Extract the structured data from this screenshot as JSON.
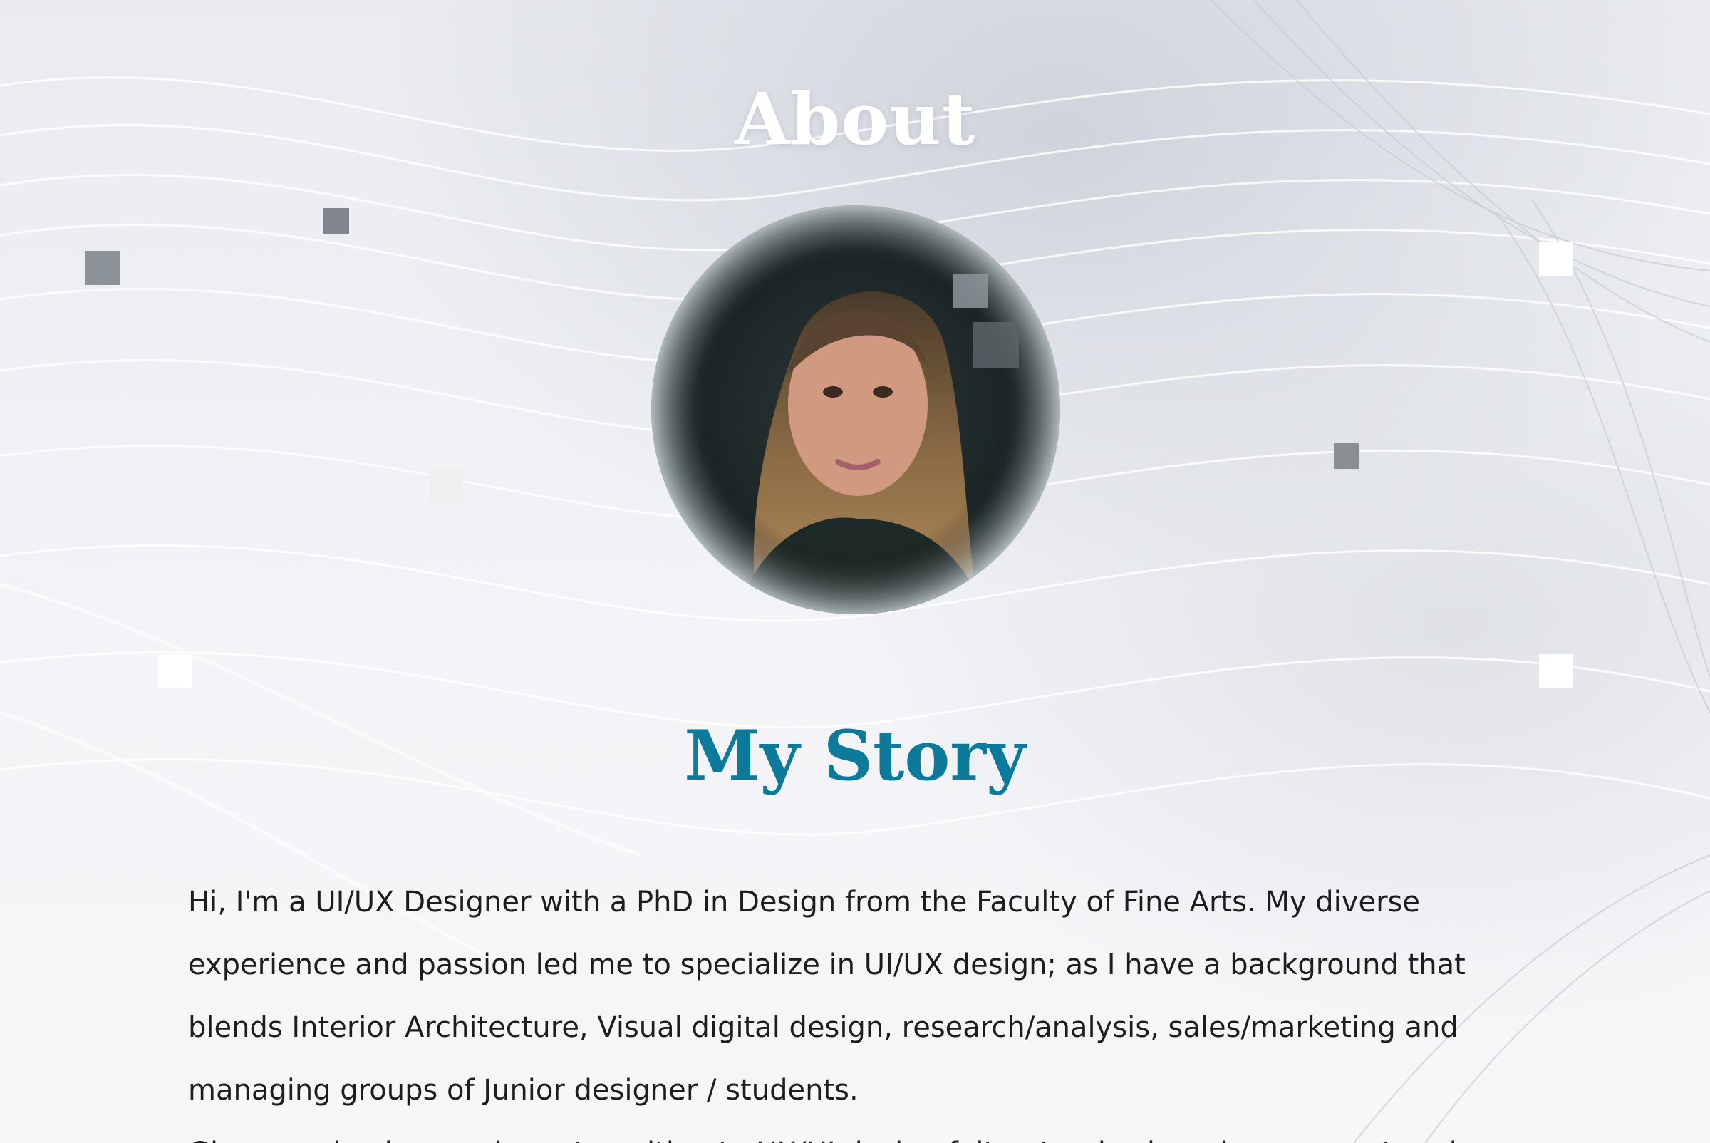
{
  "page": {
    "header_title": "About",
    "section_title": "My Story",
    "story_paragraphs": [
      "Hi, I'm a UI/UX Designer with a PhD in Design from the Faculty of Fine Arts. My diverse experience and passion led me to specialize in UI/UX design; as I have a background that blends Interior Architecture, Visual digital design, research/analysis, sales/marketing and managing groups of Junior designer / students.",
      "Given my background, my transition to UX/UI design felt natural, where human-centered"
    ]
  },
  "colors": {
    "title_white": "#ffffff",
    "accent_teal": "#0b7a9b",
    "body_text": "#1d1d1f",
    "background": "#eef0f4"
  },
  "icons": [
    "profile-photo",
    "decorative-square"
  ]
}
